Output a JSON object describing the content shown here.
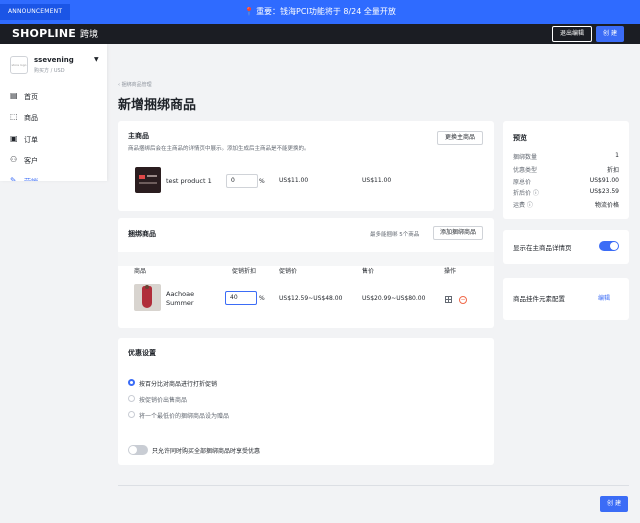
{
  "announcement": {
    "tag": "ANNOUNCEMENT",
    "pin": "📍",
    "message": "重要：钱海PCI功能将于 8/24 全量开放"
  },
  "header": {
    "logo": "SHOPLINE",
    "logo_sub": "跨境",
    "exit_label": "退出编辑",
    "create_label": "创 建"
  },
  "sidebar": {
    "store_avatar": "store logo",
    "store_name": "ssevening",
    "store_sub": "购买方 / USD",
    "items": [
      {
        "label": "首页",
        "icon": "▤"
      },
      {
        "label": "商品",
        "icon": "⬚"
      },
      {
        "label": "订单",
        "icon": "▣"
      },
      {
        "label": "客户",
        "icon": "⚇"
      },
      {
        "label": "营销",
        "icon": "✎"
      }
    ]
  },
  "page": {
    "back_label": "‹ 捆绑商品管理",
    "title": "新增捆绑商品"
  },
  "main_product": {
    "title": "主商品",
    "hint": "商品捆绑后会在主商品的详情页中展示。添加生成后主商品是不能更换的。",
    "change_label": "更换主商品",
    "product_name": "test product 1",
    "discount_value": "0",
    "percent": "%",
    "price": "US$11.00",
    "orig_price": "US$11.00"
  },
  "bundle_products": {
    "title": "捆绑商品",
    "limit_text": "最多能捆绑 5个商品",
    "add_label": "添加捆绑商品",
    "columns": [
      "商品",
      "促销折扣",
      "促销价",
      "售价",
      "操作"
    ],
    "row": {
      "name": "Aachoae Summer Beach D...",
      "discount": "40",
      "percent": "%",
      "promo_price": "US$12.59~US$48.00",
      "price": "US$20.99~US$80.00"
    }
  },
  "discount_settings": {
    "title": "优惠设置",
    "options": [
      "按百分比对商品进行打折促销",
      "按促销价出售商品",
      "将一个最低价的捆绑商品设为赠品"
    ],
    "toggle_label": "只允许同时购买全部捆绑商品时享受优惠"
  },
  "preview": {
    "title": "预览",
    "rows": [
      {
        "k": "捆绑数量",
        "v": "1"
      },
      {
        "k": "优惠类型",
        "v": "折扣"
      },
      {
        "k": "原总价",
        "v": "US$91.00"
      },
      {
        "k": "折后价 ⓘ",
        "v": "US$23.59"
      },
      {
        "k": "运费 ⓘ",
        "v": "物流价格"
      }
    ]
  },
  "display": {
    "label": "显示在主商品详情页"
  },
  "config": {
    "label": "商品挂件元素配置",
    "edit": "编辑"
  },
  "footer": {
    "create_label": "创 建"
  },
  "colors": {
    "primary": "#3b6cf6",
    "announcement": "#2f6bff",
    "header": "#1b1d23"
  }
}
